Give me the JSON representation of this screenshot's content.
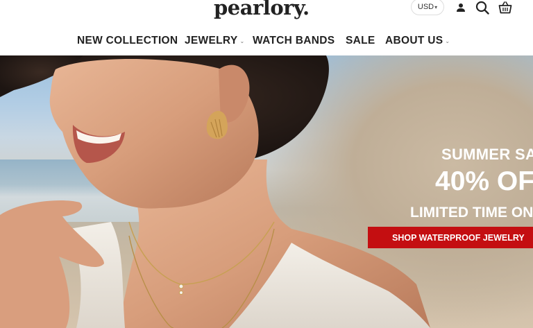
{
  "header": {
    "logo": "pearlory.",
    "currency": "USD",
    "icons": [
      "account-icon",
      "search-icon",
      "cart-icon"
    ]
  },
  "nav": {
    "items": [
      {
        "label": "NEW COLLECTION",
        "has_dropdown": false
      },
      {
        "label": "JEWELRY",
        "has_dropdown": true
      },
      {
        "label": "WATCH BANDS",
        "has_dropdown": false
      },
      {
        "label": "SALE",
        "has_dropdown": false
      },
      {
        "label": "ABOUT US",
        "has_dropdown": true
      }
    ]
  },
  "hero": {
    "line1": "SUMMER SA",
    "line2": "40% OF",
    "line3": "LIMITED TIME ON",
    "cta_label": "SHOP WATERPROOF JEWELRY"
  },
  "colors": {
    "cta_background": "#c40e11",
    "nav_text": "#222222",
    "promo_text": "#ffffff"
  }
}
